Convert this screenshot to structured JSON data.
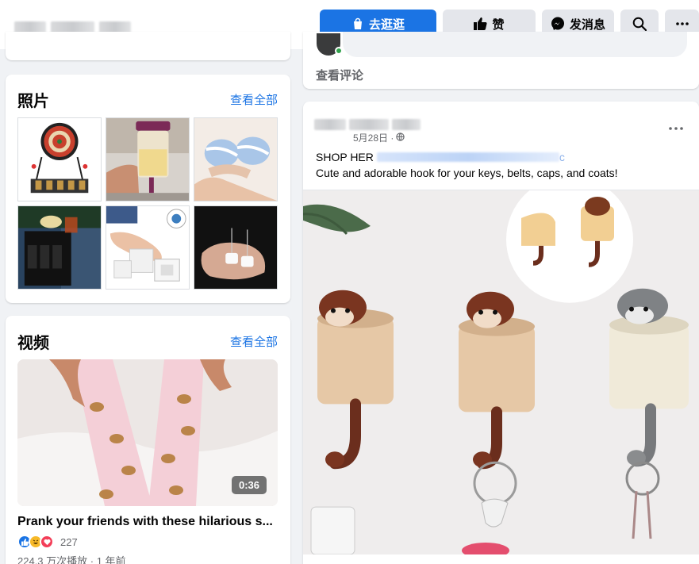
{
  "header": {
    "shop_label": "去逛逛",
    "like_label": "赞",
    "message_label": "发消息"
  },
  "photos_card": {
    "title": "照片",
    "see_all": "查看全部",
    "items": [
      "dartboard-drinking-game",
      "batter-dispenser",
      "foot-pillows",
      "sofa-armrest-caddy",
      "foot-pads",
      "toilet-paper-earrings"
    ]
  },
  "videos_card": {
    "title": "视频",
    "see_all": "查看全部",
    "duration": "0:36",
    "video_title": "Prank your friends with these hilarious s...",
    "reaction_count": "227",
    "meta": "224.3 万次播放 · 1 年前"
  },
  "prev_post": {
    "view_comments": "查看评论"
  },
  "post": {
    "date": "5月28日 ·",
    "line1_prefix": "SHOP HER",
    "line1_suffix": "c",
    "line2": "Cute and adorable hook for your keys, belts, caps, and coats!"
  },
  "colors": {
    "accent": "#1b74e4",
    "background": "#f0f2f5",
    "secondary_text": "#65676b"
  }
}
